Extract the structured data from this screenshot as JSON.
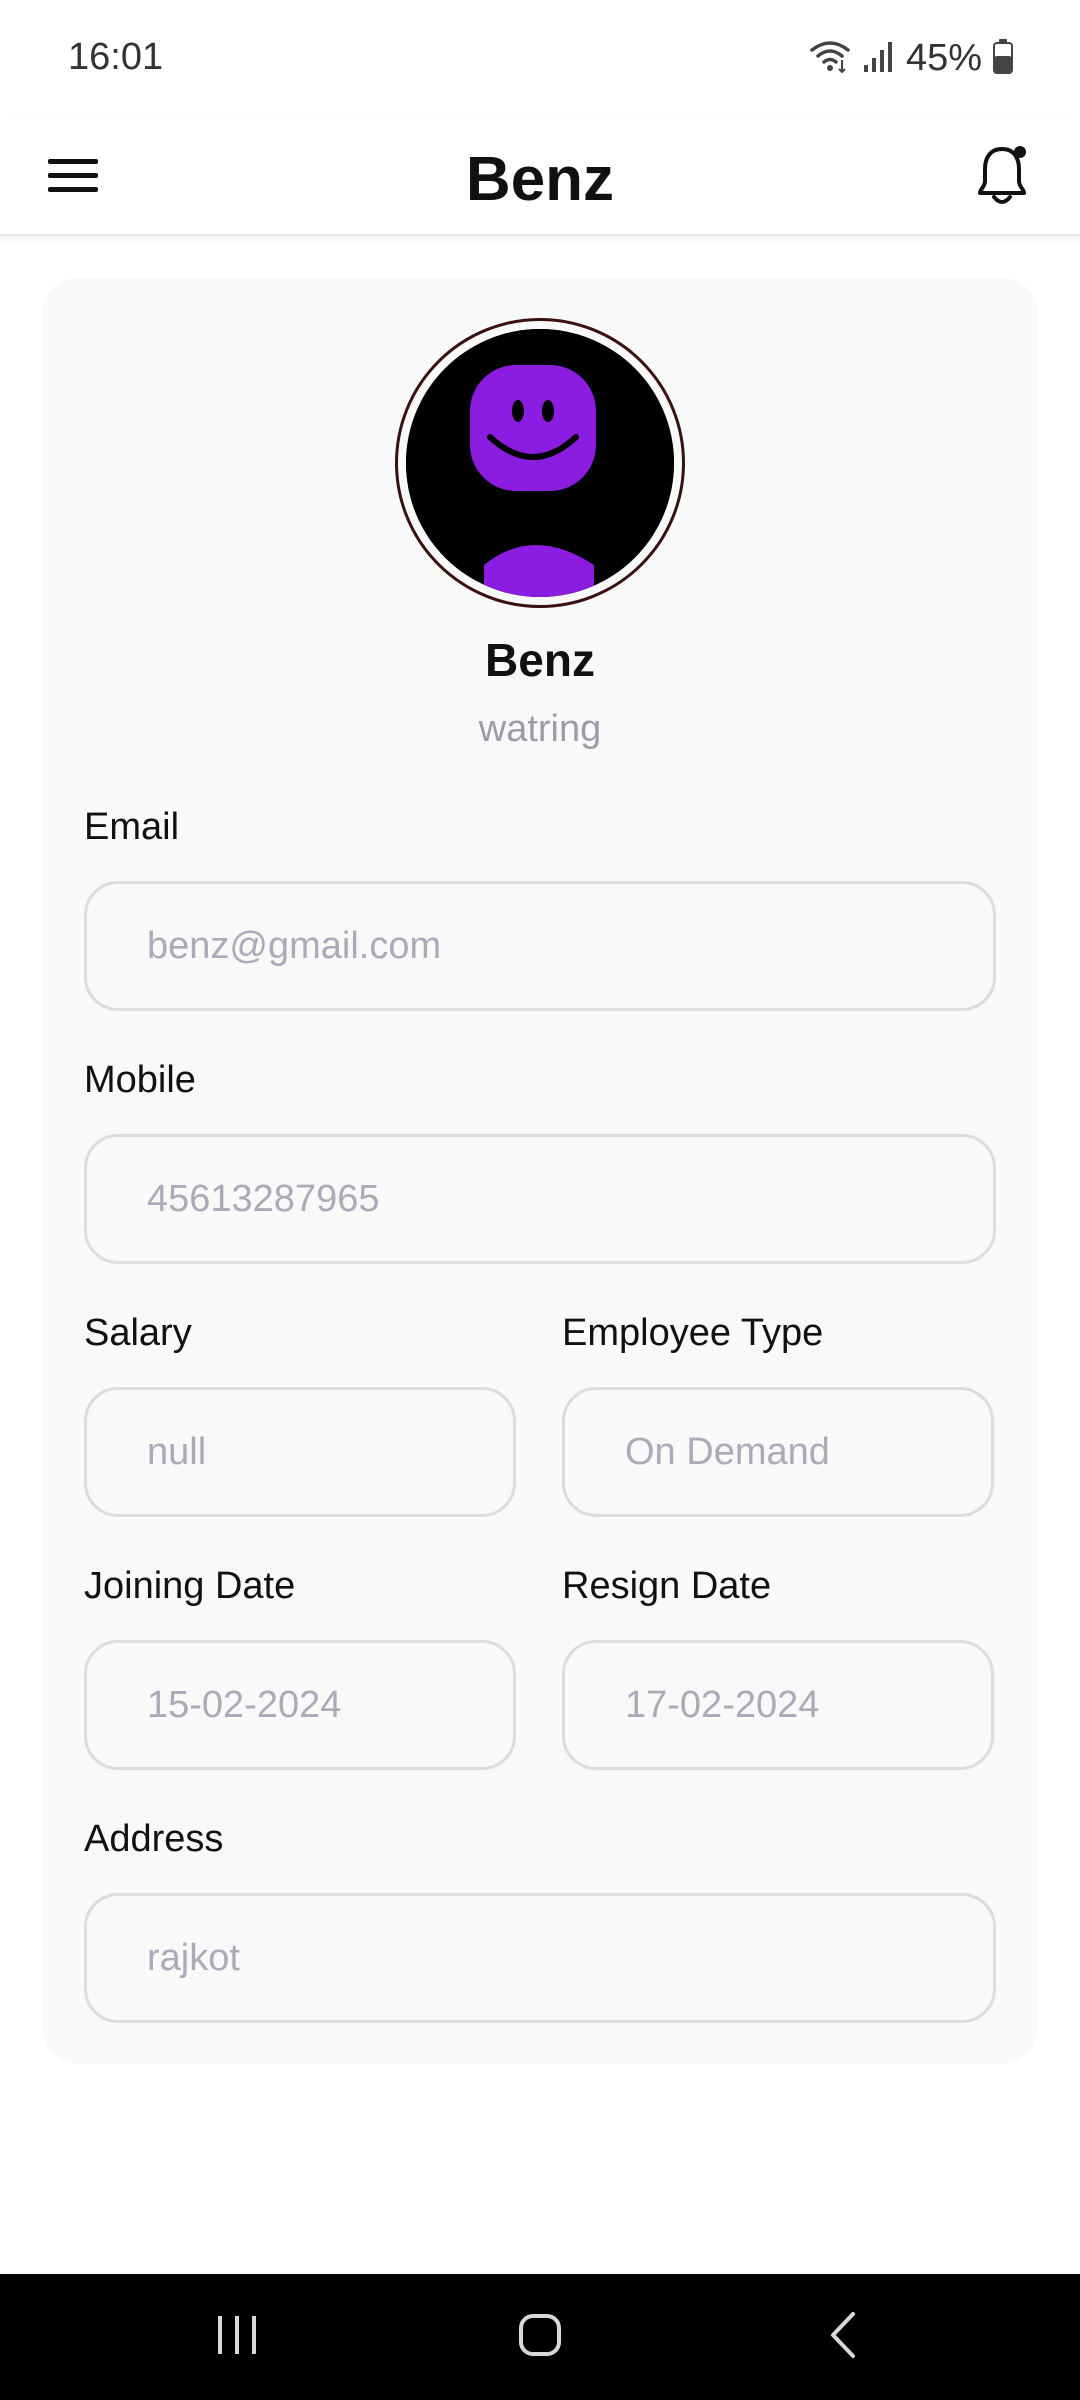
{
  "status_bar": {
    "time": "16:01",
    "battery": "45%"
  },
  "app_bar": {
    "title": "Benz",
    "icons": {
      "menu": "hamburger-menu-icon",
      "notification": "bell-icon"
    }
  },
  "profile": {
    "name": "Benz",
    "role": "watring",
    "avatar": "purple-smiley-avatar"
  },
  "fields": {
    "email": {
      "label": "Email",
      "value": "benz@gmail.com"
    },
    "mobile": {
      "label": "Mobile",
      "value": "45613287965"
    },
    "salary": {
      "label": "Salary",
      "value": "null"
    },
    "employee_type": {
      "label": "Employee Type",
      "value": "On Demand"
    },
    "joining_date": {
      "label": "Joining Date",
      "value": "15-02-2024"
    },
    "resign_date": {
      "label": "Resign Date",
      "value": "17-02-2024"
    },
    "address": {
      "label": "Address",
      "value": "rajkot"
    }
  },
  "colors": {
    "accent_avatar": "#8a1de0",
    "field_text": "#a9abb8",
    "card_background": "#f9f9f9",
    "nav_background": "#000000"
  },
  "nav_bar": {
    "icons": [
      "recent-apps-icon",
      "home-icon",
      "back-icon"
    ]
  }
}
